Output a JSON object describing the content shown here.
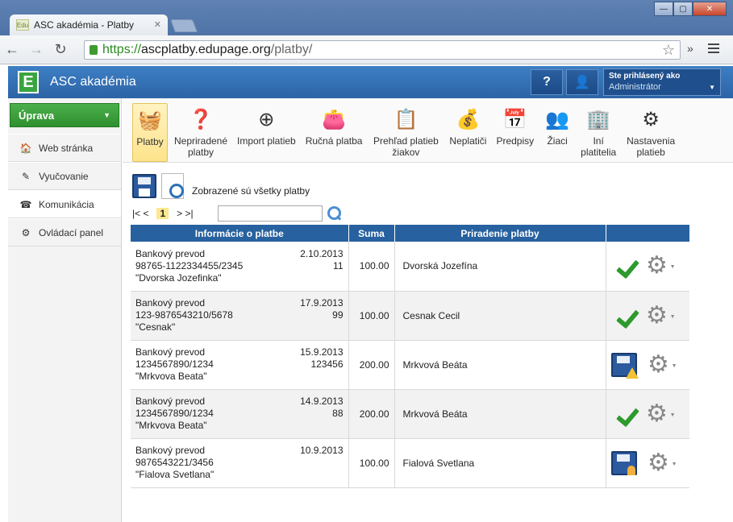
{
  "browser": {
    "tab_title": "ASC akadémia - Platby",
    "favicon_text": "Edu",
    "url_scheme": "https://",
    "url_host": "ascplatby.edupage.org",
    "url_path": "/platby/"
  },
  "header": {
    "logo_letter": "E",
    "app_name": "ASC akadémia",
    "help_label": "?",
    "user_label": "Ste prihlásený ako",
    "user_name": "Administrátor"
  },
  "sidebar": {
    "edit_button": "Úprava",
    "items": [
      {
        "label": "Web stránka",
        "icon": "house-icon"
      },
      {
        "label": "Vyučovanie",
        "icon": "teaching-icon"
      },
      {
        "label": "Komunikácia",
        "icon": "communication-icon"
      },
      {
        "label": "Ovládací panel",
        "icon": "control-panel-icon"
      }
    ]
  },
  "ribbon": {
    "items": [
      {
        "label": "Platby",
        "icon": "coins-basket-icon"
      },
      {
        "label": "Nepriradené platby",
        "icon": "unassigned-payments-icon"
      },
      {
        "label": "Import platieb",
        "icon": "import-payments-icon"
      },
      {
        "label": "Ručná platba",
        "icon": "wallet-icon"
      },
      {
        "label": "Prehľad platieb žiakov",
        "icon": "overview-icon"
      },
      {
        "label": "Neplatiči",
        "icon": "nonpayers-icon"
      },
      {
        "label": "Predpisy",
        "icon": "calendar-icon"
      },
      {
        "label": "Žiaci",
        "icon": "students-icon"
      },
      {
        "label": "Iní platitelia",
        "icon": "building-icon"
      },
      {
        "label": "Nastavenia platieb",
        "icon": "settings-gear-icon"
      }
    ]
  },
  "content": {
    "info_text": "Zobrazené sú všetky platby",
    "pager": {
      "first": "|< <",
      "current": "1",
      "last": "> >|"
    },
    "table": {
      "headers": [
        "Informácie o platbe",
        "Suma",
        "Priradenie platby",
        ""
      ],
      "rows": [
        {
          "type": "Bankový prevod",
          "account": "98765-1122334455/2345",
          "name": "\"Dvorska Jozefinka\"",
          "date": "2.10.2013",
          "vs": "11",
          "sum": "100.00",
          "assigned": "Dvorská Jozefína",
          "status": "assigned"
        },
        {
          "type": "Bankový prevod",
          "account": "123-9876543210/5678",
          "name": "\"Cesnak\"",
          "date": "17.9.2013",
          "vs": "99",
          "sum": "100.00",
          "assigned": "Cesnak Cecil",
          "status": "assigned"
        },
        {
          "type": "Bankový prevod",
          "account": "1234567890/1234",
          "name": "\"Mrkvova Beata\"",
          "date": "15.9.2013",
          "vs": "123456",
          "sum": "200.00",
          "assigned": "Mrkvová Beáta",
          "status": "warning"
        },
        {
          "type": "Bankový prevod",
          "account": "1234567890/1234",
          "name": "\"Mrkvova Beata\"",
          "date": "14.9.2013",
          "vs": "88",
          "sum": "200.00",
          "assigned": "Mrkvová Beáta",
          "status": "assigned"
        },
        {
          "type": "Bankový prevod",
          "account": "9876543221/3456",
          "name": "\"Fialova Svetlana\"",
          "date": "10.9.2013",
          "vs": "",
          "sum": "100.00",
          "assigned": "Fialová Svetlana",
          "status": "pending"
        }
      ]
    }
  }
}
